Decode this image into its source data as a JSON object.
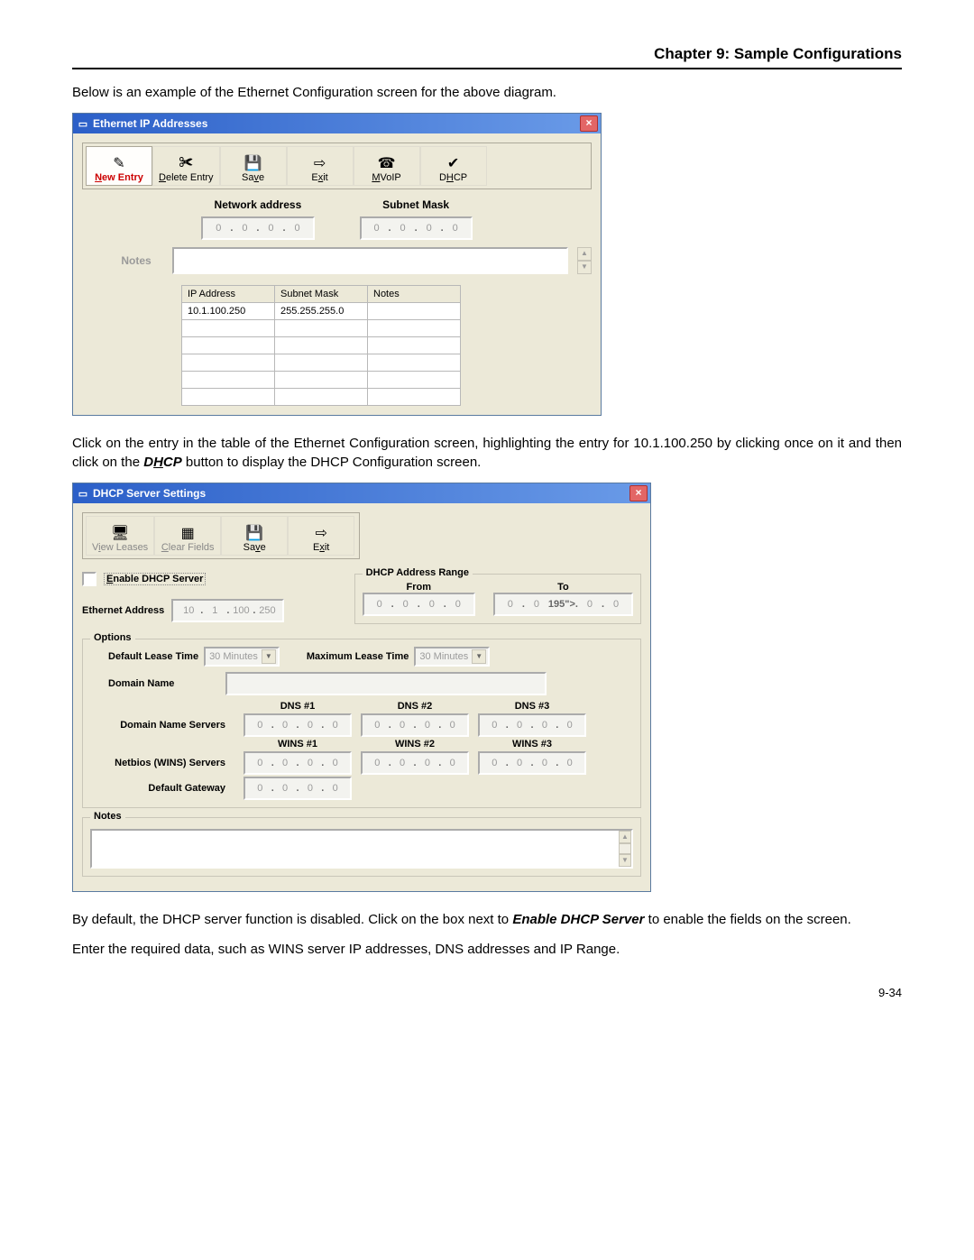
{
  "chapter_title": "Chapter 9: Sample Configurations",
  "intro_text": "Below is an example of the Ethernet Configuration screen for the above diagram.",
  "page_number": "9-34",
  "mid_text": "Click on the entry in the table of the Ethernet Configuration screen, highlighting the entry for 10.1.100.250 by clicking once on it and then click on the ",
  "mid_bold": "DHCP",
  "mid_tail": " button to display the DHCP Configuration screen.",
  "para3_a": "By default, the DHCP server function is disabled.  Click on the box next to ",
  "para3_b": "Enable DHCP Server",
  "para3_c": " to enable the fields on the screen.",
  "para4": "Enter the required data, such as WINS server IP addresses, DNS addresses and IP Range.",
  "dialog1": {
    "title": "Ethernet IP Addresses",
    "toolbar": [
      {
        "label_pre": "",
        "label_ul": "N",
        "label_post": "ew Entry",
        "class": "newentry",
        "icon": "✎"
      },
      {
        "label_pre": "",
        "label_ul": "D",
        "label_post": "elete Entry",
        "icon": "✂"
      },
      {
        "label_pre": "Sa",
        "label_ul": "v",
        "label_post": "e",
        "icon": "💾"
      },
      {
        "label_pre": "E",
        "label_ul": "x",
        "label_post": "it",
        "icon": "⇨"
      },
      {
        "label_pre": "",
        "label_ul": "M",
        "label_post": "VoIP",
        "icon": "📞"
      },
      {
        "label_pre": "D",
        "label_ul": "H",
        "label_post": "CP",
        "icon": "✔"
      }
    ],
    "net_addr_label": "Network address",
    "subnet_label": "Subnet Mask",
    "notes_label": "Notes",
    "ip_placeholder": [
      "0",
      "0",
      "0",
      "0"
    ],
    "table": {
      "headers": [
        "IP Address",
        "Subnet Mask",
        "Notes"
      ],
      "row": [
        "10.1.100.250",
        "255.255.255.0",
        ""
      ]
    }
  },
  "dialog2": {
    "title": "DHCP Server Settings",
    "toolbar": [
      {
        "label_pre": "V",
        "label_ul": "i",
        "label_post": "ew Leases",
        "icon": "🖥"
      },
      {
        "label_pre": "",
        "label_ul": "C",
        "label_post": "lear Fields",
        "icon": "🧽"
      },
      {
        "label_pre": "Sa",
        "label_ul": "v",
        "label_post": "e",
        "icon": "💾"
      },
      {
        "label_pre": "E",
        "label_ul": "x",
        "label_post": "it",
        "icon": "⇨"
      }
    ],
    "enable_label_pre": "",
    "enable_label_ul": "E",
    "enable_label_post": "nable DHCP Server",
    "eth_addr_label": "Ethernet Address",
    "eth_addr": [
      "10",
      "1",
      "100",
      "250"
    ],
    "range_title": "DHCP Address Range",
    "from_label": "From",
    "to_label": "To",
    "options_title": "Options",
    "default_lease_label": "Default Lease Time",
    "max_lease_label": "Maximum Lease Time",
    "lease_value": "30 Minutes",
    "domain_name_label": "Domain Name",
    "dns_servers_label": "Domain Name Servers",
    "wins_servers_label": "Netbios (WINS) Servers",
    "default_gw_label": "Default Gateway",
    "dns_headers": [
      "DNS #1",
      "DNS #2",
      "DNS #3"
    ],
    "wins_headers": [
      "WINS #1",
      "WINS #2",
      "WINS #3"
    ],
    "notes_label": "Notes",
    "ip_placeholder": [
      "0",
      "0",
      "0",
      "0"
    ]
  }
}
